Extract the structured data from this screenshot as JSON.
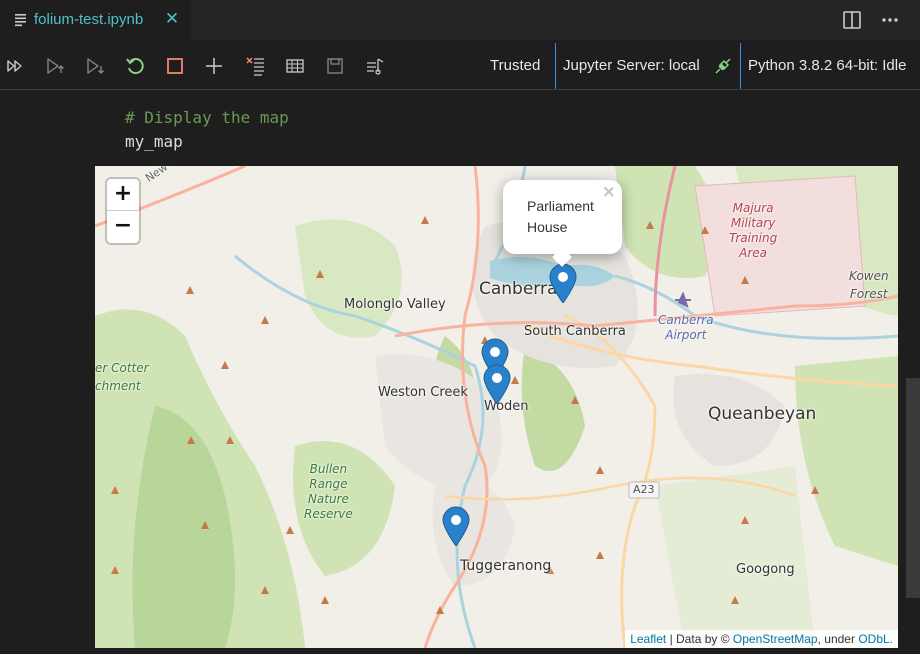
{
  "tab": {
    "filename": "folium-test.ipynb",
    "close": "✕"
  },
  "toolbar": {
    "trusted": "Trusted",
    "server": "Jupyter Server: local",
    "kernel": "Python 3.8.2 64-bit: Idle"
  },
  "code": {
    "comment": "# Display the map",
    "expr": "my_map"
  },
  "map": {
    "zoom_in": "+",
    "zoom_out": "−",
    "popup": {
      "text": "Parliament House",
      "close": "×"
    },
    "labels": {
      "canberra": "Canberra",
      "south_canberra": "South Canberra",
      "molonglo": "Molonglo Valley",
      "weston_creek": "Weston Creek",
      "woden": "Woden",
      "queanbeyan": "Queanbeyan",
      "tuggeranong": "Tuggeranong",
      "googong": "Googong",
      "cotter": "er Cotter\nchment",
      "bullen": "Bullen\nRange\nNature\nReserve",
      "majura": "Majura\nMilitary\nTraining\nArea",
      "airport": "Canberra\nAirport",
      "kowen": "Kowen\nForest",
      "road": "A23",
      "nsw": "New South"
    },
    "attribution": {
      "leaflet": "Leaflet",
      "sep1": " | Data by © ",
      "osm": "OpenStreetMap",
      "sep2": ", under ",
      "odbl": "ODbL."
    }
  },
  "colors": {
    "accent": "#4fc1c9",
    "marker": "#2a81cb",
    "separator": "#3a8ee6"
  }
}
